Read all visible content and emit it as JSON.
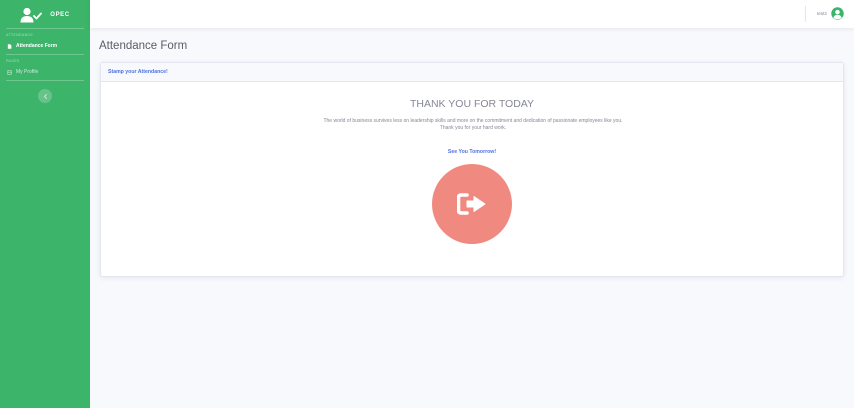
{
  "sidebar": {
    "brand": "OPEC",
    "heading_attendance": "ATTENDANCE",
    "item_attendance_form": "Attendance Form",
    "heading_pages": "PAGES",
    "item_my_profile": "My Profile",
    "toggle_icon": "chevron-left-icon"
  },
  "topbar": {
    "user_name": "test2",
    "avatar_icon": "user-circle-icon"
  },
  "main": {
    "page_title": "Attendance Form",
    "card_header": "Stamp your Attendance!",
    "thank_title": "THANK YOU FOR TODAY",
    "message_line1": "The world of business survives less on leadership skills and more on the commitment and dedication of passionate employees like you.",
    "message_line2": "Thank you for your hard work.",
    "see_you": "See You Tomorrow!",
    "clockout_icon": "sign-out-icon"
  },
  "colors": {
    "sidebar": "#3cb46a",
    "accent": "#4e73df",
    "clockout": "#f08a80",
    "avatar": "#3cb46a"
  }
}
